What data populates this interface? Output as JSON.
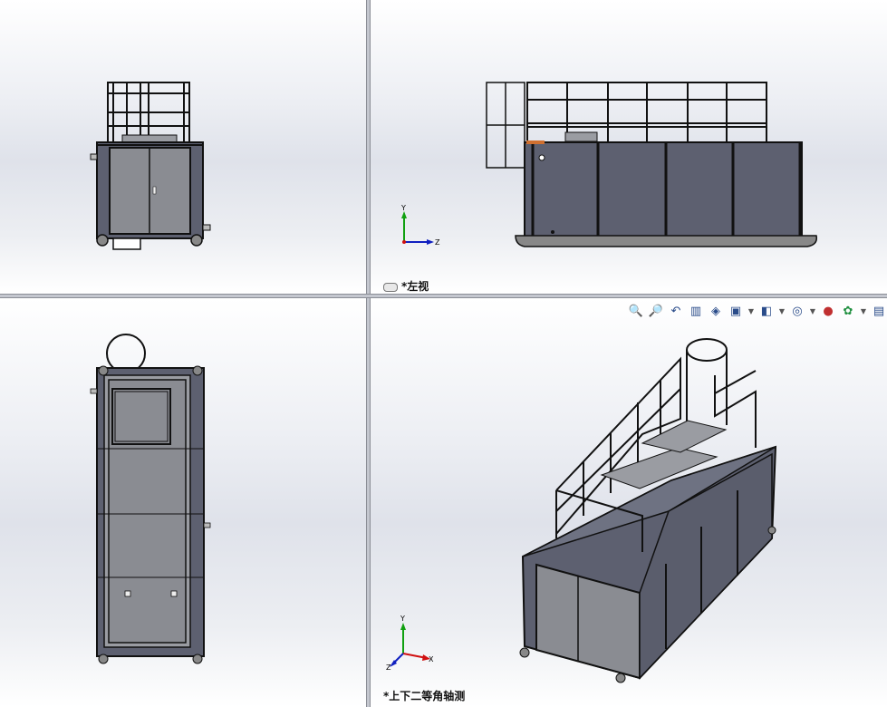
{
  "viewports": {
    "top_left": {
      "label": ""
    },
    "top_right": {
      "label": "*左视"
    },
    "bottom_left": {
      "label": ""
    },
    "bottom_right": {
      "label": "*上下二等角轴测"
    }
  },
  "triad": {
    "x": "X",
    "y": "Y",
    "z": "Z"
  },
  "toolbar": {
    "icons": [
      "zoom-to-fit-icon",
      "zoom-area-icon",
      "previous-view-icon",
      "section-view-icon",
      "dynamic-annotation-icon",
      "view-orientation-icon",
      "display-style-icon",
      "hide-show-items-icon",
      "edit-appearance-icon",
      "apply-scene-icon",
      "view-settings-icon"
    ]
  },
  "colors": {
    "body_fill": "#5d6070",
    "door_fill": "#8a8c92",
    "frame": "#111111",
    "axis_x": "#d01010",
    "axis_y": "#10a010",
    "axis_z": "#1020c0"
  }
}
